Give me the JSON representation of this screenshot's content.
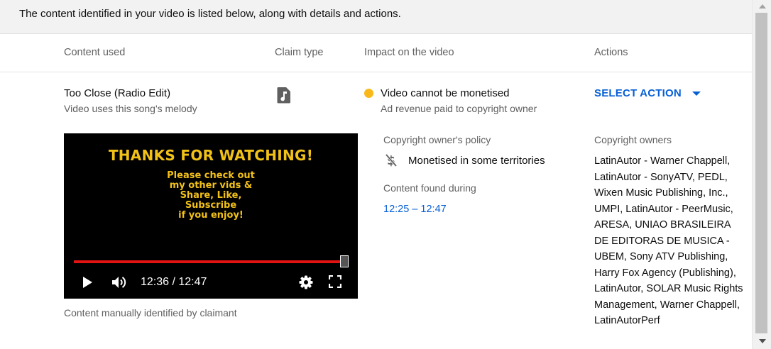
{
  "banner": {
    "text": "The content identified in your video is listed below, along with details and actions."
  },
  "columns": {
    "content_used": "Content used",
    "claim_type": "Claim type",
    "impact": "Impact on the video",
    "actions": "Actions"
  },
  "claim": {
    "title": "Too Close (Radio Edit)",
    "subtitle": "Video uses this song's melody",
    "claim_type_icon": "music-note-icon",
    "impact_status": "Video cannot be monetised",
    "impact_detail": "Ad revenue paid to copyright owner",
    "impact_color": "#f9b91a",
    "action_label": "SELECT ACTION",
    "identification_note": "Content manually identified by claimant"
  },
  "player": {
    "heading": "THANKS FOR WATCHING!",
    "message_lines": [
      "Please check out",
      "my other vids &",
      "Share, Like,",
      "Subscribe",
      "if you enjoy!"
    ],
    "time_display": "12:36 / 12:47",
    "progress": 0.985,
    "text_color": "#f2c118",
    "progress_color": "#e21313"
  },
  "policy": {
    "label": "Copyright owner's policy",
    "value": "Monetised in some territories",
    "icon": "no-money-icon"
  },
  "found": {
    "label": "Content found during",
    "range": "12:25 – 12:47"
  },
  "owners": {
    "label": "Copyright owners",
    "text": "LatinAutor - Warner Chappell, LatinAutor - SonyATV, PEDL, Wixen Music Publishing, Inc., UMPI, LatinAutor - PeerMusic, ARESA, UNIAO BRASILEIRA DE EDITORAS DE MUSICA - UBEM, Sony ATV Publishing, Harry Fox Agency (Publishing), LatinAutor, SOLAR Music Rights Management, Warner Chappell, LatinAutorPerf"
  },
  "colors": {
    "accent": "#065fd4"
  }
}
